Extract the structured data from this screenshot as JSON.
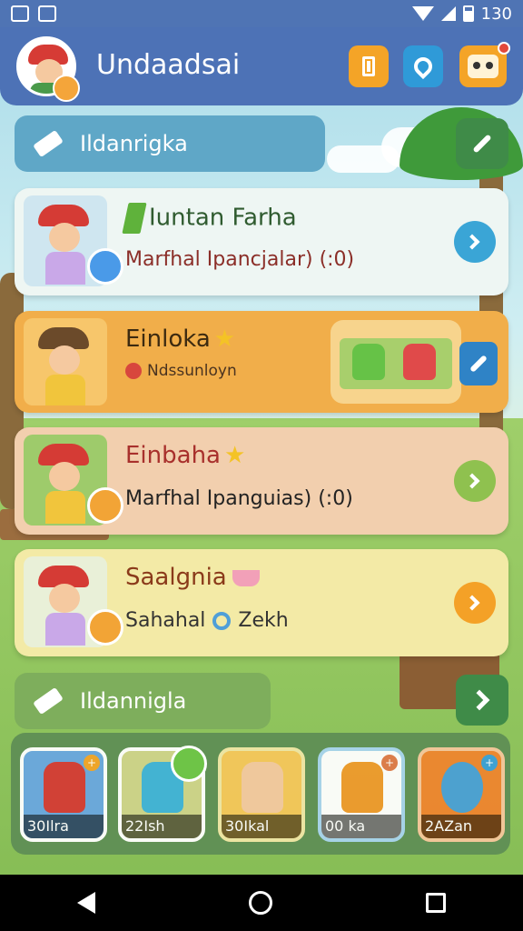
{
  "statusbar": {
    "battery": "130"
  },
  "app": {
    "title": "Undaadsai"
  },
  "sections": [
    {
      "label": "Ildanrigka"
    },
    {
      "label": "Ildannigla"
    }
  ],
  "cards": [
    {
      "title": "Iuntan Farha",
      "subtitle": "Marfhal Ipancjalar) (:0)"
    },
    {
      "title": "Einloka",
      "subtitle": "Ndssunloyn"
    },
    {
      "title": "Einbaha",
      "subtitle": "Marfhal Ipanguias) (:0)"
    },
    {
      "title": "Saalgnia",
      "subtitle_left": "Sahahal",
      "subtitle_right": "Zekh"
    }
  ],
  "tray": [
    {
      "label": "30Ilra",
      "badge": "+"
    },
    {
      "label": "22Ish",
      "badge": ""
    },
    {
      "label": "30Ikal",
      "badge": ""
    },
    {
      "label": "00 ka",
      "badge": "+"
    },
    {
      "label": "2AZan",
      "badge": "+"
    }
  ],
  "colors": {
    "header": "#4d72b6",
    "accent_orange": "#f4a427",
    "accent_blue": "#2f9ad8",
    "accent_green": "#3f8b48"
  },
  "icons": {
    "header_buttons": [
      "document-icon",
      "location-pin-icon",
      "robot-icon"
    ],
    "nav": [
      "back-icon",
      "home-icon",
      "recents-icon"
    ]
  }
}
